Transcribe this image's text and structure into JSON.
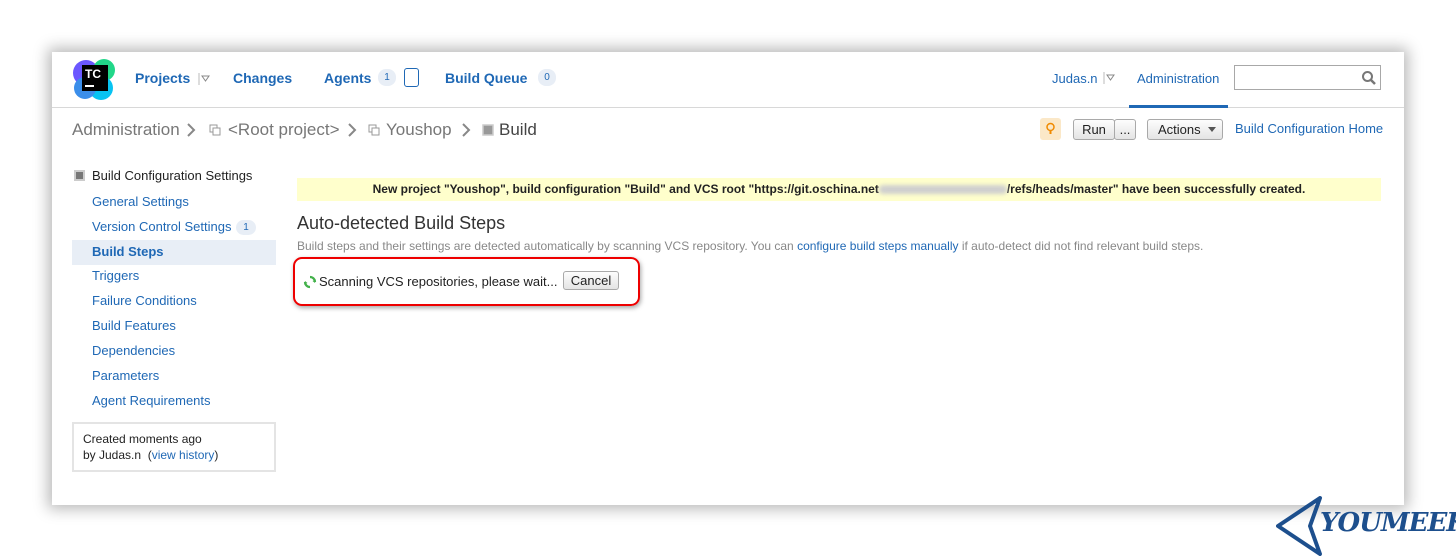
{
  "header": {
    "logo_text": "TC",
    "nav": {
      "projects": "Projects",
      "changes": "Changes",
      "agents": "Agents",
      "agents_count": "1",
      "build_queue": "Build Queue",
      "build_queue_count": "0"
    },
    "user": "Judas.n",
    "admin_tab": "Administration",
    "search_placeholder": ""
  },
  "breadcrumb": {
    "items": [
      "Administration",
      "<Root project>",
      "Youshop",
      "Build"
    ]
  },
  "toolbar": {
    "run_label": "Run",
    "run_more_label": "...",
    "actions_label": "Actions",
    "bc_home_label": "Build Configuration Home"
  },
  "sidebar": {
    "heading": "Build Configuration Settings",
    "items": [
      {
        "label": "General Settings"
      },
      {
        "label": "Version Control Settings",
        "count": "1"
      },
      {
        "label": "Build Steps"
      },
      {
        "label": "Triggers"
      },
      {
        "label": "Failure Conditions"
      },
      {
        "label": "Build Features"
      },
      {
        "label": "Dependencies"
      },
      {
        "label": "Parameters"
      },
      {
        "label": "Agent Requirements"
      }
    ],
    "info": {
      "line1": "Created moments ago",
      "line2_prefix": "by Judas.n",
      "link": "view history"
    }
  },
  "main": {
    "banner_before": "New project \"Youshop\", build configuration \"Build\" and VCS root \"https://git.oschina.net",
    "banner_after": "/refs/heads/master\" have been successfully created.",
    "title": "Auto-detected Build Steps",
    "desc_before": "Build steps and their settings are detected automatically by scanning VCS repository. You can ",
    "desc_link": "configure build steps manually",
    "desc_after": " if auto-detect did not find relevant build steps.",
    "scan_text": "Scanning VCS repositories, please wait...",
    "cancel_label": "Cancel"
  },
  "watermark": {
    "text": "YOUMEEK"
  },
  "colors": {
    "link": "#1f68b5",
    "banner": "#ffffcc",
    "highlight_border": "#ee0000",
    "active_item_bg": "#e8eef6"
  }
}
